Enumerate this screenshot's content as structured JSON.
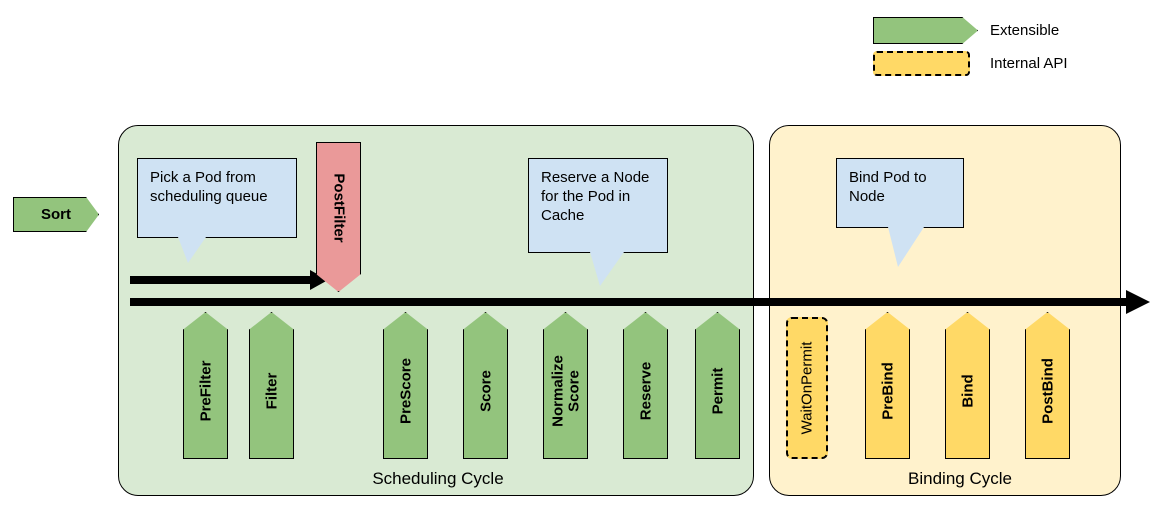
{
  "legend": {
    "extensible_label": "Extensible",
    "internal_label": "Internal API"
  },
  "sort_label": "Sort",
  "scheduling_cycle": {
    "title": "Scheduling Cycle",
    "postfilter": "PostFilter",
    "stages": {
      "prefilter": "PreFilter",
      "filter": "Filter",
      "prescore": "PreScore",
      "score": "Score",
      "normalize": "Normalize\nScore",
      "reserve": "Reserve",
      "permit": "Permit"
    },
    "callouts": {
      "pick": "Pick a Pod from scheduling queue",
      "reserve_note": "Reserve a Node for the Pod in Cache"
    }
  },
  "binding_cycle": {
    "title": "Binding Cycle",
    "waitonpermit": "WaitOnPermit",
    "stages": {
      "prebind": "PreBind",
      "bind": "Bind",
      "postbind": "PostBind"
    },
    "callouts": {
      "bind_note": "Bind Pod to Node"
    }
  },
  "colors": {
    "green_fill": "#93c47d",
    "green_box": "#d9ead3",
    "yellow_fill": "#ffd966",
    "yellow_box": "#fff2cc",
    "red_fill": "#ea9999",
    "blue_fill": "#cfe2f3"
  }
}
